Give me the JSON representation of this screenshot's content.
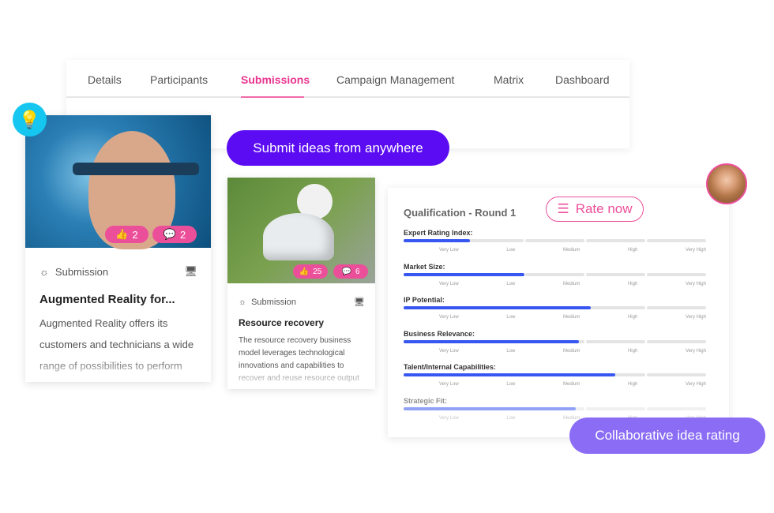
{
  "tabs": [
    {
      "label": "Details"
    },
    {
      "label": "Participants"
    },
    {
      "label": "Submissions",
      "active": true
    },
    {
      "label": "Campaign Management"
    },
    {
      "label": "Matrix"
    },
    {
      "label": "Dashboard"
    }
  ],
  "submit_banner": "Submit ideas from anywhere",
  "cards": [
    {
      "type": "Submission",
      "title": "Augmented Reality for...",
      "description": "Augmented Reality offers its customers and technicians a wide range of possibilities to perform",
      "likes": "2",
      "comments": "2"
    },
    {
      "type": "Submission",
      "title": "Resource recovery",
      "description": "The resource recovery business model leverages technological innovations and capabilities to recover and reuse resource output",
      "likes": "25",
      "comments": "6"
    }
  ],
  "rating": {
    "title": "Qualification - Round 1",
    "rate_button": "Rate now",
    "scale": [
      "Very Low",
      "Low",
      "Medium",
      "High",
      "Very High"
    ],
    "criteria": [
      {
        "label": "Expert Rating Index:",
        "value": 0.22
      },
      {
        "label": "Market Size:",
        "value": 0.4
      },
      {
        "label": "IP Potential:",
        "value": 0.62
      },
      {
        "label": "Business Relevance:",
        "value": 0.58
      },
      {
        "label": "Talent/Internal Capabilities:",
        "value": 0.7
      },
      {
        "label": "Strategic Fit:",
        "value": 0.57,
        "faded": true
      }
    ]
  },
  "collab_banner": "Collaborative idea rating",
  "colors": {
    "accent": "#ec4f9a",
    "submit": "#5b0cf2",
    "collab": "#8a6cf5",
    "bar": "#3857f0",
    "bulb": "#14c6f0"
  }
}
